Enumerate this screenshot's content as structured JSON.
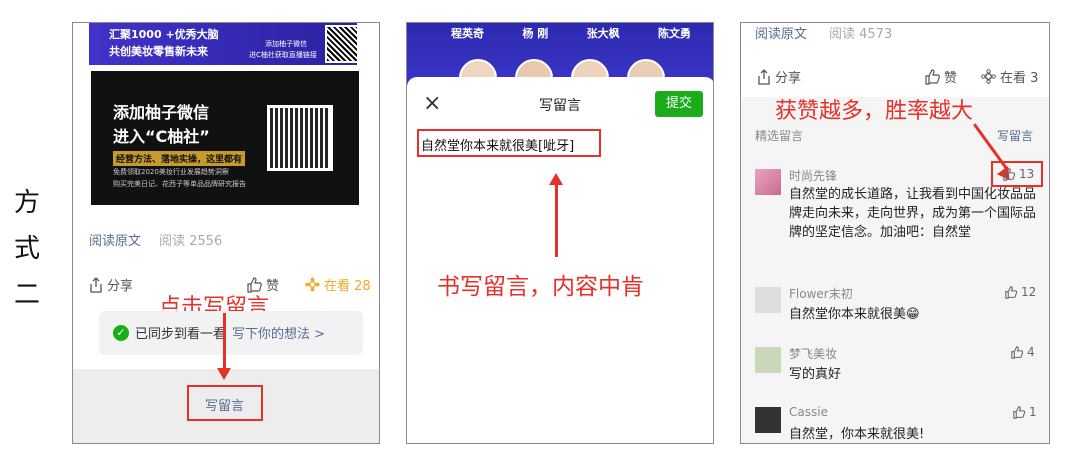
{
  "side_label": [
    "方",
    "式",
    "二"
  ],
  "panel1": {
    "banner_top": {
      "line1": "汇聚1000 +优秀大脑",
      "line2": "共创美妆零售新未来",
      "side1": "添加柚子微信",
      "side2": "进C柚社获取直播链接"
    },
    "promo": {
      "line1": "添加柚子微信",
      "line2": "进入“C柚社”",
      "tagline": "经营方法、落地实操，这里都有",
      "sub1": "免费领取2020美妆行业发展趋势洞察",
      "sub2": "购买完美日记、花西子等单品品牌研究报告"
    },
    "read_original": "阅读原文",
    "read_count": "阅读 2556",
    "share": "分享",
    "like": "赞",
    "watching": "在看 28",
    "annotation": "点击写留言",
    "sync_text": "已同步到看一看",
    "write_thought": "写下你的想法 >",
    "write_comment": "写留言"
  },
  "panel2": {
    "speakers": [
      "程英奇",
      "杨 刚",
      "张大枫",
      "陈文勇"
    ],
    "close": "×",
    "title": "写留言",
    "submit": "提交",
    "comment_text": "自然堂你本来就很美[呲牙]",
    "annotation": "书写留言，内容中肯"
  },
  "panel3": {
    "read_original": "阅读原文",
    "read_count": "阅读 4573",
    "share": "分享",
    "like": "赞",
    "watching": "在看 3",
    "annotation": "获赞越多，胜率越大",
    "featured": "精选留言",
    "write_comment": "写留言",
    "comments": [
      {
        "user": "时尚先锋",
        "text": "自然堂的成长道路，让我看到中国化妆品品牌走向未来，走向世界，成为第一个国际品牌的坚定信念。加油吧：自然堂",
        "likes": "13"
      },
      {
        "user": "Flower末初",
        "text": "自然堂你本来就很美😁",
        "likes": "12"
      },
      {
        "user": "梦飞美妆",
        "text": "写的真好",
        "likes": "4"
      },
      {
        "user": "Cassie",
        "text": "自然堂，你本来就很美!",
        "likes": "1"
      }
    ]
  },
  "colors": {
    "red": "#e8302a",
    "green": "#1aad19",
    "blue_banner": "#3b2fb5",
    "wechat_blue": "#576b95",
    "gold": "#f5a623"
  }
}
